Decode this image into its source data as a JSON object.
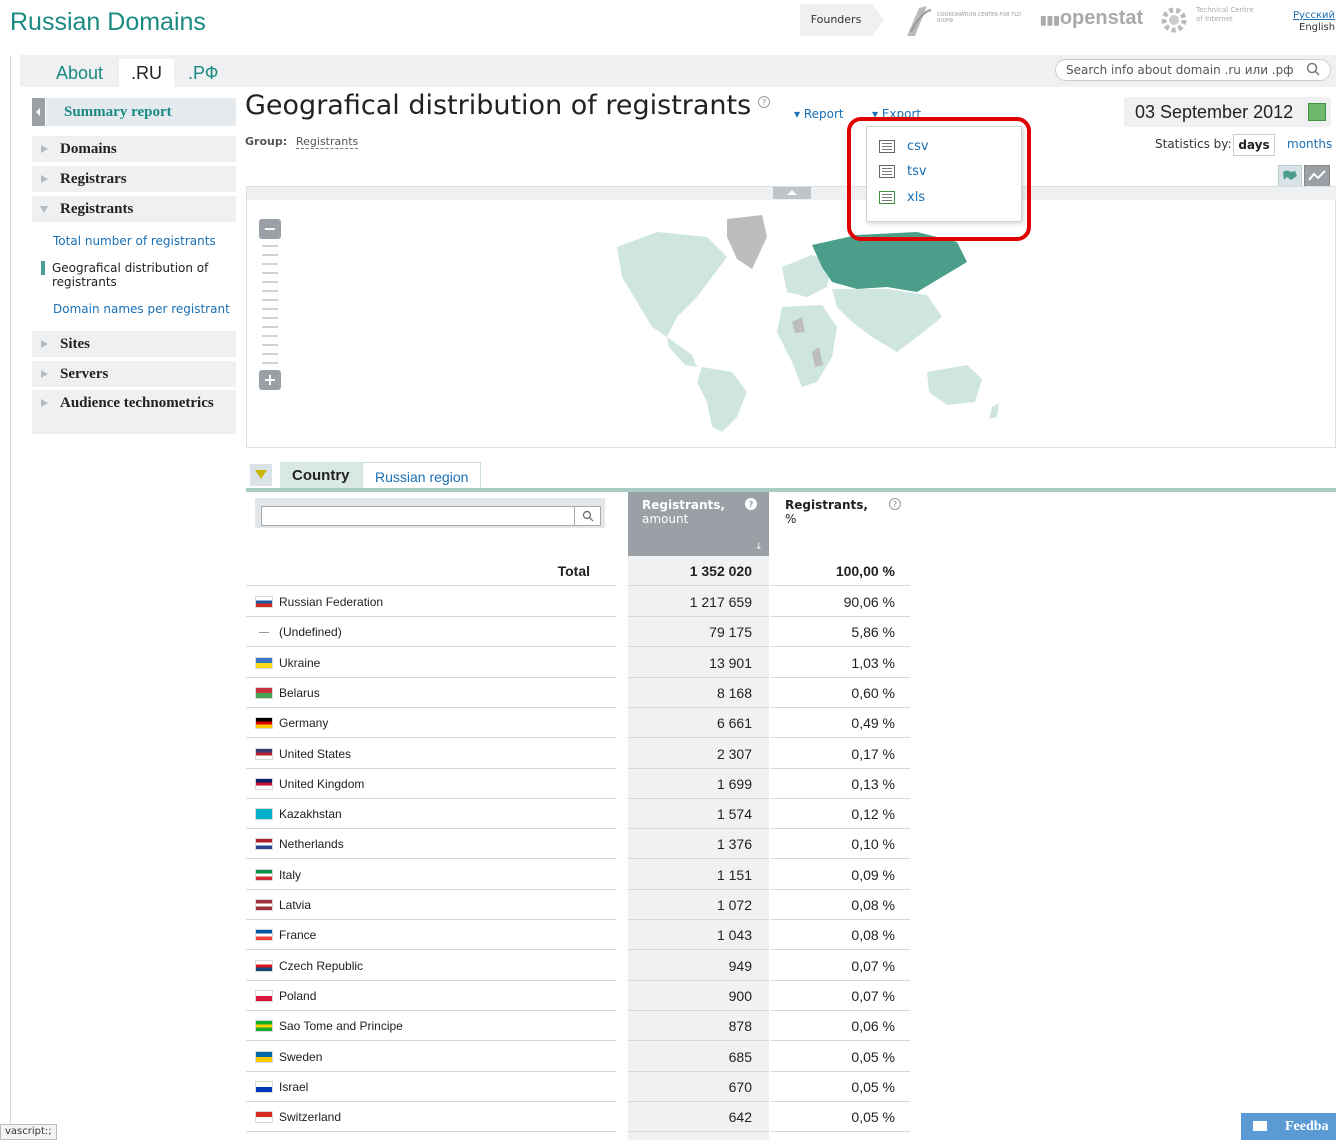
{
  "header": {
    "site_title": "Russian Domains",
    "founders_label": "Founders",
    "cc_logo_text": "COORDINATION CENTER FOR TLD RU/РФ",
    "openstat_logo": "openstat",
    "tci_logo_text": "Technical Centre of Internet",
    "lang_ru": "Русский",
    "lang_en": "English"
  },
  "tabs": [
    {
      "label": "About"
    },
    {
      "label": ".RU"
    },
    {
      "label": ".РФ"
    }
  ],
  "search": {
    "placeholder": "Search info about domain .ru или .рф"
  },
  "sidebar": {
    "summary": "Summary report",
    "items": [
      {
        "label": "Domains"
      },
      {
        "label": "Registrars"
      },
      {
        "label": "Registrants"
      },
      {
        "label": "Sites"
      },
      {
        "label": "Servers"
      },
      {
        "label": "Audience technometrics"
      }
    ],
    "subitems": [
      {
        "label": "Total number of registrants"
      },
      {
        "label": "Geografical distribution of registrants"
      },
      {
        "label": "Domain names per registrant"
      }
    ]
  },
  "main": {
    "title": "Geografical distribution of registrants",
    "report_label": "▾ Report",
    "export_label": "▾ Export",
    "group_label": "Group:",
    "group_value": "Registrants",
    "date": "03 September 2012",
    "stats_label": "Statistics by:",
    "stats_days": "days",
    "stats_months": "months"
  },
  "export_menu": [
    {
      "label": "csv"
    },
    {
      "label": "tsv"
    },
    {
      "label": "xls"
    }
  ],
  "data_tabs": {
    "country": "Country",
    "region": "Russian region"
  },
  "table": {
    "col_amount_title": "Registrants,",
    "col_amount_sub": "amount",
    "col_pct_title": "Registrants,",
    "col_pct_sub": "%",
    "total_label": "Total",
    "total_amount": "1 352 020",
    "total_pct": "100,00 %",
    "rows": [
      {
        "name": "Russian Federation",
        "amount": "1 217 659",
        "pct": "90,06 %",
        "flag": [
          "#ffffff",
          "#1c57a5",
          "#d52b1e"
        ]
      },
      {
        "name": "(Undefined)",
        "amount": "79 175",
        "pct": "5,86 %",
        "flag": []
      },
      {
        "name": "Ukraine",
        "amount": "13 901",
        "pct": "1,03 %",
        "flag": [
          "#3a75c4",
          "#f9dd16"
        ]
      },
      {
        "name": "Belarus",
        "amount": "8 168",
        "pct": "0,60 %",
        "flag": [
          "#c8313e",
          "#4aa657"
        ]
      },
      {
        "name": "Germany",
        "amount": "6 661",
        "pct": "0,49 %",
        "flag": [
          "#000000",
          "#dd0000",
          "#ffce00"
        ]
      },
      {
        "name": "United States",
        "amount": "2 307",
        "pct": "0,17 %",
        "flag": [
          "#3c3b6e",
          "#b22234",
          "#ffffff"
        ]
      },
      {
        "name": "United Kingdom",
        "amount": "1 699",
        "pct": "0,13 %",
        "flag": [
          "#012169",
          "#c8102e",
          "#ffffff"
        ]
      },
      {
        "name": "Kazakhstan",
        "amount": "1 574",
        "pct": "0,12 %",
        "flag": [
          "#00afca"
        ]
      },
      {
        "name": "Netherlands",
        "amount": "1 376",
        "pct": "0,10 %",
        "flag": [
          "#ae1c28",
          "#ffffff",
          "#21468b"
        ]
      },
      {
        "name": "Italy",
        "amount": "1 151",
        "pct": "0,09 %",
        "flag": [
          "#009246",
          "#ffffff",
          "#ce2b37"
        ]
      },
      {
        "name": "Latvia",
        "amount": "1 072",
        "pct": "0,08 %",
        "flag": [
          "#9e3039",
          "#ffffff",
          "#9e3039"
        ]
      },
      {
        "name": "France",
        "amount": "1 043",
        "pct": "0,08 %",
        "flag": [
          "#0055a4",
          "#ffffff",
          "#ef4135"
        ]
      },
      {
        "name": "Czech Republic",
        "amount": "949",
        "pct": "0,07 %",
        "flag": [
          "#ffffff",
          "#d7141a",
          "#11457e"
        ]
      },
      {
        "name": "Poland",
        "amount": "900",
        "pct": "0,07 %",
        "flag": [
          "#ffffff",
          "#dc143c"
        ]
      },
      {
        "name": "Sao Tome and Principe",
        "amount": "878",
        "pct": "0,06 %",
        "flag": [
          "#12ad2b",
          "#ffce00",
          "#12ad2b"
        ]
      },
      {
        "name": "Sweden",
        "amount": "685",
        "pct": "0,05 %",
        "flag": [
          "#006aa7",
          "#fecc00"
        ]
      },
      {
        "name": "Israel",
        "amount": "670",
        "pct": "0,05 %",
        "flag": [
          "#ffffff",
          "#0038b8"
        ]
      },
      {
        "name": "Switzerland",
        "amount": "642",
        "pct": "0,05 %",
        "flag": [
          "#d52b1e",
          "#ffffff"
        ]
      }
    ]
  },
  "status_bar": "vascript:;",
  "feedback": "Feedba",
  "colors": {
    "brand": "#1a8a82",
    "link": "#1a6fb5",
    "highlight": "#e00000",
    "map_base": "#cfe5df",
    "map_russia": "#4a9e8a"
  }
}
